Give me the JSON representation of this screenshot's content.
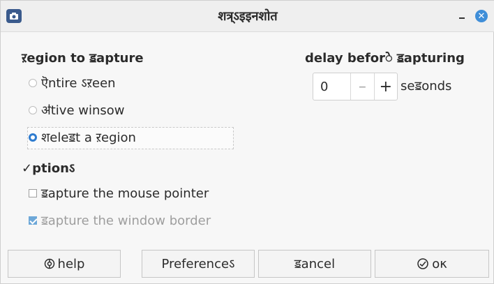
{
  "window": {
    "title": "शत्र्ऽइइनशोत",
    "icons": {
      "app": "camera-icon",
      "minimize": "minimize-icon",
      "close": "close-icon"
    }
  },
  "region": {
    "heading": "ऱegion to ॾapture",
    "options": [
      {
        "label": "ऎntire ऽऱeen",
        "checked": false
      },
      {
        "label": "ॳtive winsow",
        "checked": false
      },
      {
        "label": "शeleॾt a ऱegion",
        "checked": true
      }
    ]
  },
  "options": {
    "heading": "✓ptionऽ",
    "items": [
      {
        "label": "ॾapture the mouse pointer",
        "checked": false,
        "disabled": false
      },
      {
        "label": "ॾapture the window border",
        "checked": true,
        "disabled": true
      }
    ]
  },
  "delay": {
    "heading": "delay beforे ॾapturing",
    "value": "0",
    "minus": "–",
    "plus": "+",
    "unit": "seॾonds"
  },
  "buttons": {
    "help": "help",
    "preferences": "Preferenceऽ",
    "cancel": "ॾancel",
    "ok": "oκ"
  },
  "colors": {
    "accent": "#2f7ccf",
    "close": "#3f8ed8"
  }
}
